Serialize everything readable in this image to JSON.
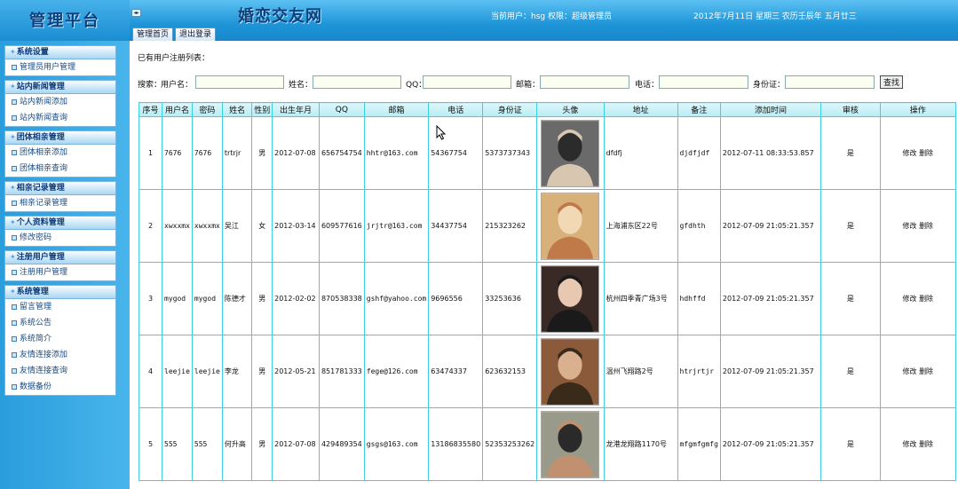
{
  "header": {
    "logo": "管理平台",
    "site_title": "婚恋交友网",
    "user_info": "当前用户：hsg 权限：超级管理员",
    "date_info": "2012年7月11日 星期三 农历壬辰年 五月廿三",
    "tabs": [
      "管理首页",
      "退出登录"
    ]
  },
  "sidebar": {
    "groups": [
      {
        "title": "系统设置",
        "items": [
          "管理员用户管理"
        ]
      },
      {
        "title": "站内新闻管理",
        "items": [
          "站内新闻添加",
          "站内新闻查询"
        ]
      },
      {
        "title": "团体相亲管理",
        "items": [
          "团体相亲添加",
          "团体相亲查询"
        ]
      },
      {
        "title": "相亲记录管理",
        "items": [
          "相亲记录管理"
        ]
      },
      {
        "title": "个人资料管理",
        "items": [
          "修改密码"
        ]
      },
      {
        "title": "注册用户管理",
        "items": [
          "注册用户管理"
        ]
      },
      {
        "title": "系统管理",
        "items": [
          "留言管理",
          "系统公告",
          "系统简介",
          "友情连接添加",
          "友情连接查询",
          "数据备份"
        ]
      }
    ]
  },
  "main": {
    "heading": "已有用户注册列表：",
    "search": {
      "prefix": "搜索：",
      "username_label": "用户名：",
      "name_label": "姓名：",
      "qq_label": "QQ：",
      "email_label": "邮箱：",
      "phone_label": "电话：",
      "idcard_label": "身份证：",
      "button": "查找"
    },
    "table": {
      "headers": [
        "序号",
        "用户名",
        "密码",
        "姓名",
        "性别",
        "出生年月",
        "QQ",
        "邮箱",
        "电话",
        "身份证",
        "头像",
        "地址",
        "备注",
        "添加时间",
        "审核",
        "操作"
      ],
      "edit_label": "修改",
      "delete_label": "删除",
      "rows": [
        {
          "no": "1",
          "username": "7676",
          "password": "7676",
          "name": "trtrjr",
          "gender": "男",
          "birth": "2012-07-08",
          "qq": "656754754",
          "email": "hhtr@163.com",
          "phone": "54367754",
          "idcard": "5373737343",
          "address": "dfdfj",
          "remark": "djdfjdf",
          "added": "2012-07-11 08:33:53.857",
          "audit": "是"
        },
        {
          "no": "2",
          "username": "xwxxmx",
          "password": "xwxxmx",
          "name": "吴江",
          "gender": "女",
          "birth": "2012-03-14",
          "qq": "609577616",
          "email": "jrjtr@163.com",
          "phone": "34437754",
          "idcard": "215323262",
          "address": "上海浦东区22号",
          "remark": "gfdhth",
          "added": "2012-07-09 21:05:21.357",
          "audit": "是"
        },
        {
          "no": "3",
          "username": "mygod",
          "password": "mygod",
          "name": "陈德才",
          "gender": "男",
          "birth": "2012-02-02",
          "qq": "870538338",
          "email": "gshf@yahoo.com",
          "phone": "9696556",
          "idcard": "33253636",
          "address": "杭州四季青广场3号",
          "remark": "hdhffd",
          "added": "2012-07-09 21:05:21.357",
          "audit": "是"
        },
        {
          "no": "4",
          "username": "leejie",
          "password": "leejie",
          "name": "李龙",
          "gender": "男",
          "birth": "2012-05-21",
          "qq": "851781333",
          "email": "fege@126.com",
          "phone": "63474337",
          "idcard": "623632153",
          "address": "温州飞翔路2号",
          "remark": "htrjrtjr",
          "added": "2012-07-09 21:05:21.357",
          "audit": "是"
        },
        {
          "no": "5",
          "username": "555",
          "password": "555",
          "name": "何升高",
          "gender": "男",
          "birth": "2012-07-08",
          "qq": "429489354",
          "email": "gsgs@163.com",
          "phone": "13186835580",
          "idcard": "52353253262",
          "address": "龙港龙翔路1170号",
          "remark": "mfgmfgmfg",
          "added": "2012-07-09 21:05:21.357",
          "audit": "是"
        }
      ]
    }
  },
  "colors": {
    "header_top": "#5cc0f2",
    "header_bottom": "#1787cb",
    "sidebar": "#2a9ddc",
    "table_border": "#3fd0e0",
    "table_header": "#b7ecf3"
  }
}
